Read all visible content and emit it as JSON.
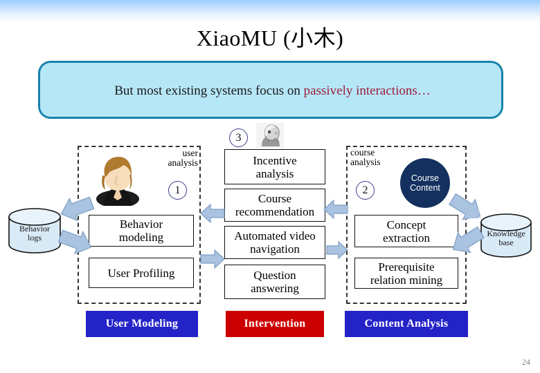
{
  "slide": {
    "title": "XiaoMU (小木)",
    "page_number": "24",
    "accent_callout_bg": "#b6e7f7",
    "accent_callout_border": "#1683aa",
    "accent_blue": "#2323c8",
    "accent_red": "#cc0000",
    "accent_navy": "#13305f",
    "arrow_fill": "#a9c3e0"
  },
  "callout": {
    "text_plain": "But most existing systems focus on ",
    "text_highlight": "passively interactions",
    "text_ellipsis": "…"
  },
  "groups": {
    "user_analysis": {
      "caption_line1": "user",
      "caption_line2": "analysis",
      "number": "1"
    },
    "course_analysis": {
      "caption_line1": "course",
      "caption_line2": "analysis",
      "number": "2"
    },
    "intervention": {
      "number": "3"
    }
  },
  "datastores": {
    "behavior_logs": {
      "line1": "Behavior",
      "line2": "logs"
    },
    "knowledge_base": {
      "line1": "Knowledge",
      "line2": "base"
    },
    "course_content": {
      "line1": "Course",
      "line2": "Content"
    }
  },
  "columns": {
    "user_modeling": {
      "legend": "User Modeling",
      "boxes": [
        {
          "line1": "Behavior",
          "line2": "modeling"
        },
        {
          "line1": "User Profiling",
          "line2": ""
        }
      ]
    },
    "intervention": {
      "legend": "Intervention",
      "boxes": [
        {
          "line1": "Incentive",
          "line2": "analysis"
        },
        {
          "line1": "Course",
          "line2": "recommendation"
        },
        {
          "line1": "Automated video",
          "line2": "navigation"
        },
        {
          "line1": "Question",
          "line2": "answering"
        }
      ]
    },
    "content_analysis": {
      "legend": "Content Analysis",
      "boxes": [
        {
          "line1": "Concept",
          "line2": "extraction"
        },
        {
          "line1": "Prerequisite",
          "line2": "relation mining"
        }
      ]
    }
  }
}
